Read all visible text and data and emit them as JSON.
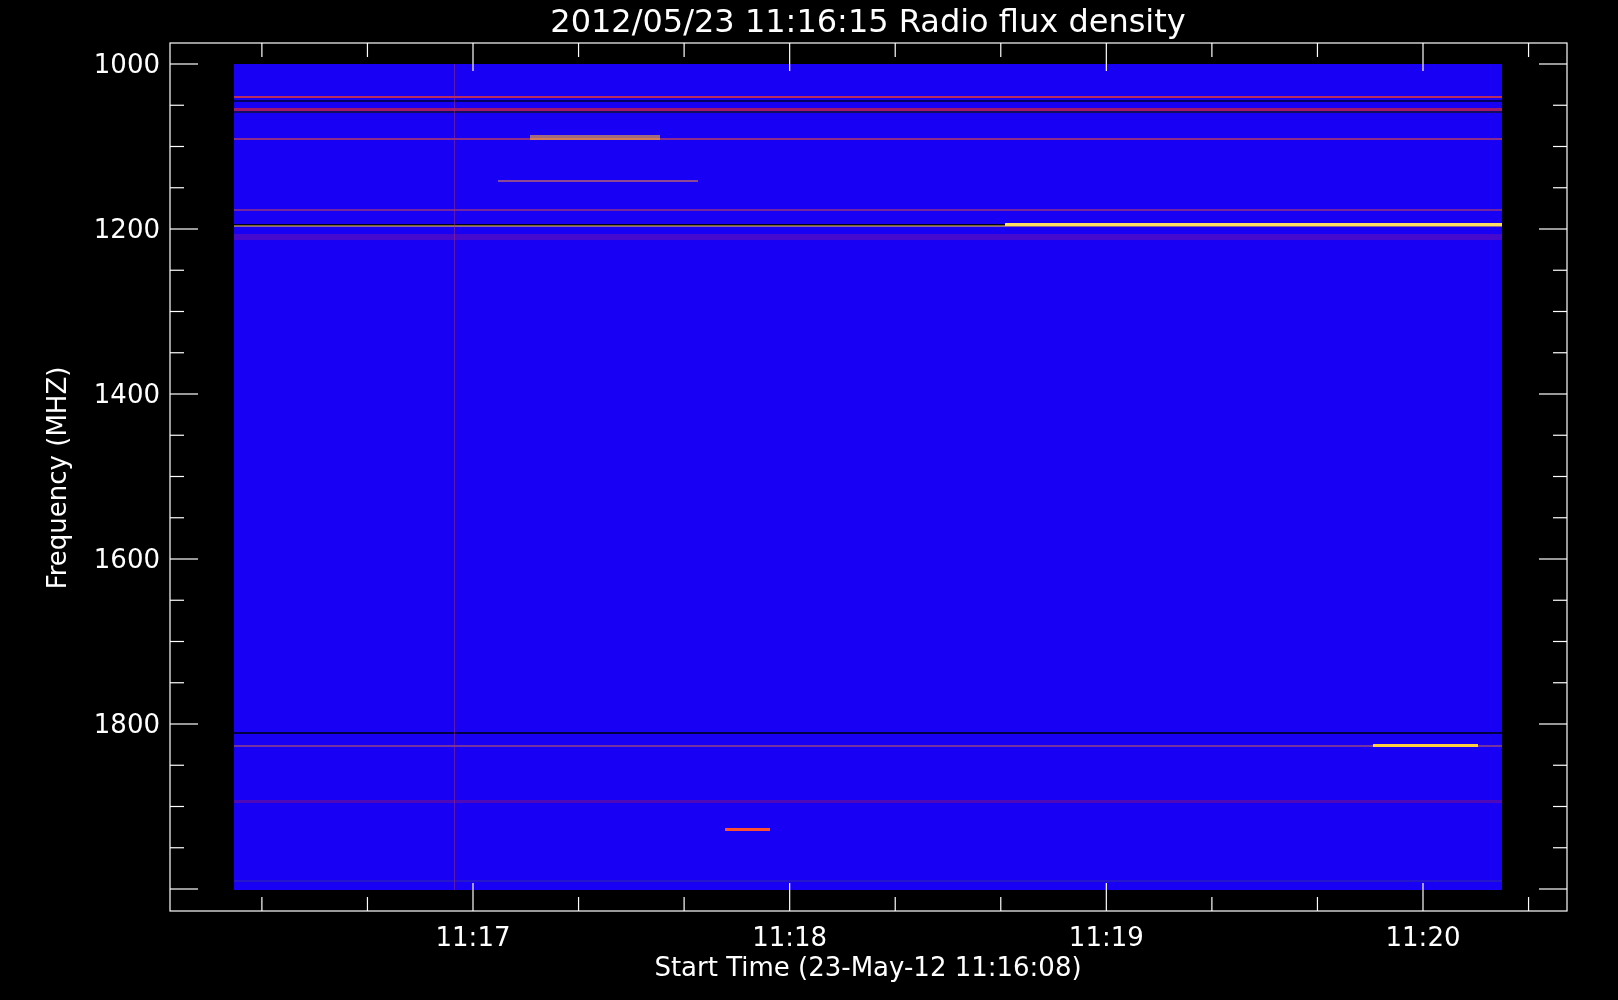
{
  "title": "2012/05/23 11:16:15 Radio flux density",
  "y_axis": {
    "label": "Frequency (MHZ)",
    "ticks": [
      "1000",
      "1200",
      "1400",
      "1600",
      "1800"
    ]
  },
  "x_axis": {
    "label": "Start Time (23-May-12 11:16:08)",
    "ticks": [
      "11:17",
      "11:18",
      "11:19",
      "11:20"
    ]
  }
}
